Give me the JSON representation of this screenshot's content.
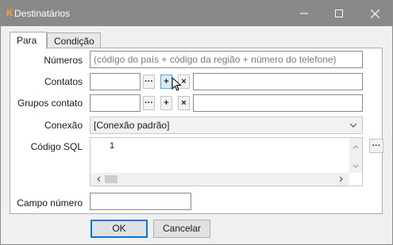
{
  "window": {
    "title": "Destinatários",
    "app_icon": "app-k-icon",
    "controls": [
      "minimize-icon",
      "maximize-icon",
      "close-icon"
    ]
  },
  "tabs": [
    {
      "label": "Para",
      "active": true
    },
    {
      "label": "Condição",
      "active": false
    }
  ],
  "form": {
    "numeros_label": "Números",
    "numeros_placeholder": "(código do país + código da região + número do telefone)",
    "contatos_label": "Contatos",
    "grupos_label": "Grupos contato",
    "conexao_label": "Conexão",
    "conexao_value": "[Conexão padrão]",
    "sql_label": "Código SQL",
    "sql_line_number": "1",
    "campo_label": "Campo número",
    "browse_glyph": "···",
    "add_glyph": "+",
    "remove_glyph": "×",
    "sql_button_glyph": "···"
  },
  "buttons": {
    "ok": "OK",
    "cancel": "Cancelar"
  },
  "colors": {
    "titlebar": "#898989",
    "accent": "#0078d7",
    "hover": "#dbeaf8"
  }
}
